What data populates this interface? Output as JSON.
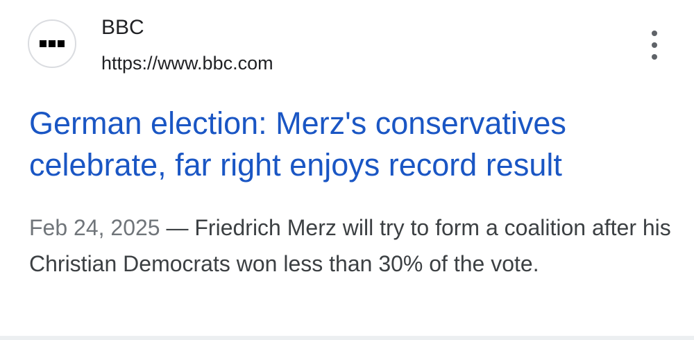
{
  "result": {
    "favicon_icon": "bbc-logo-icon",
    "site_name": "BBC",
    "url": "https://www.bbc.com",
    "menu_icon": "more-vert-icon",
    "title": "German election: Merz's conservatives celebrate, far right enjoys record result",
    "date": "Feb 24, 2025",
    "separator": " — ",
    "snippet": "Friedrich Merz will try to form a coalition after his Christian Democrats won less than 30% of the vote."
  },
  "colors": {
    "title_link": "#1a56c4",
    "text": "#202124",
    "snippet": "#3c4043",
    "date": "#70757a",
    "icon": "#5f6368"
  }
}
